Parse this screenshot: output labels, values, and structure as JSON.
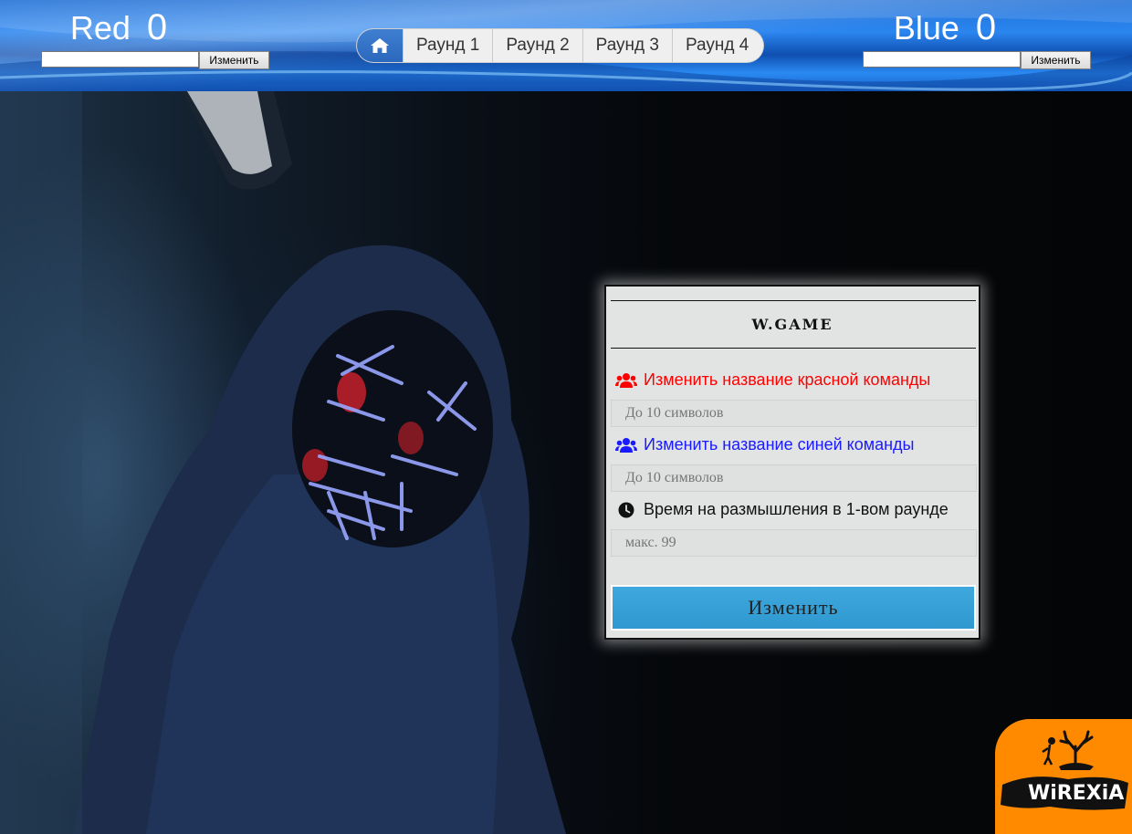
{
  "top_bar": {
    "red_team": {
      "name": "Red",
      "score": "0",
      "input_value": "",
      "button_label": "Изменить"
    },
    "blue_team": {
      "name": "Blue",
      "score": "0",
      "input_value": "",
      "button_label": "Изменить"
    },
    "nav": {
      "home_icon": "home-icon",
      "rounds": [
        "Раунд 1",
        "Раунд 2",
        "Раунд 3",
        "Раунд 4"
      ]
    }
  },
  "panel": {
    "title": "W.GAME",
    "red_label": "Изменить название красной команды",
    "red_placeholder": "До 10 символов",
    "blue_label": "Изменить название синей команды",
    "blue_placeholder": "До 10 символов",
    "time_label": "Время на размышления в 1-вом раунде",
    "time_placeholder": "макс. 99",
    "submit_label": "Изменить",
    "colors": {
      "red": "#ff0000",
      "blue": "#1a1aff",
      "accent": "#3aa4da"
    }
  },
  "logo": {
    "text": "WiREXiA",
    "bg_color": "#ff8a00"
  }
}
